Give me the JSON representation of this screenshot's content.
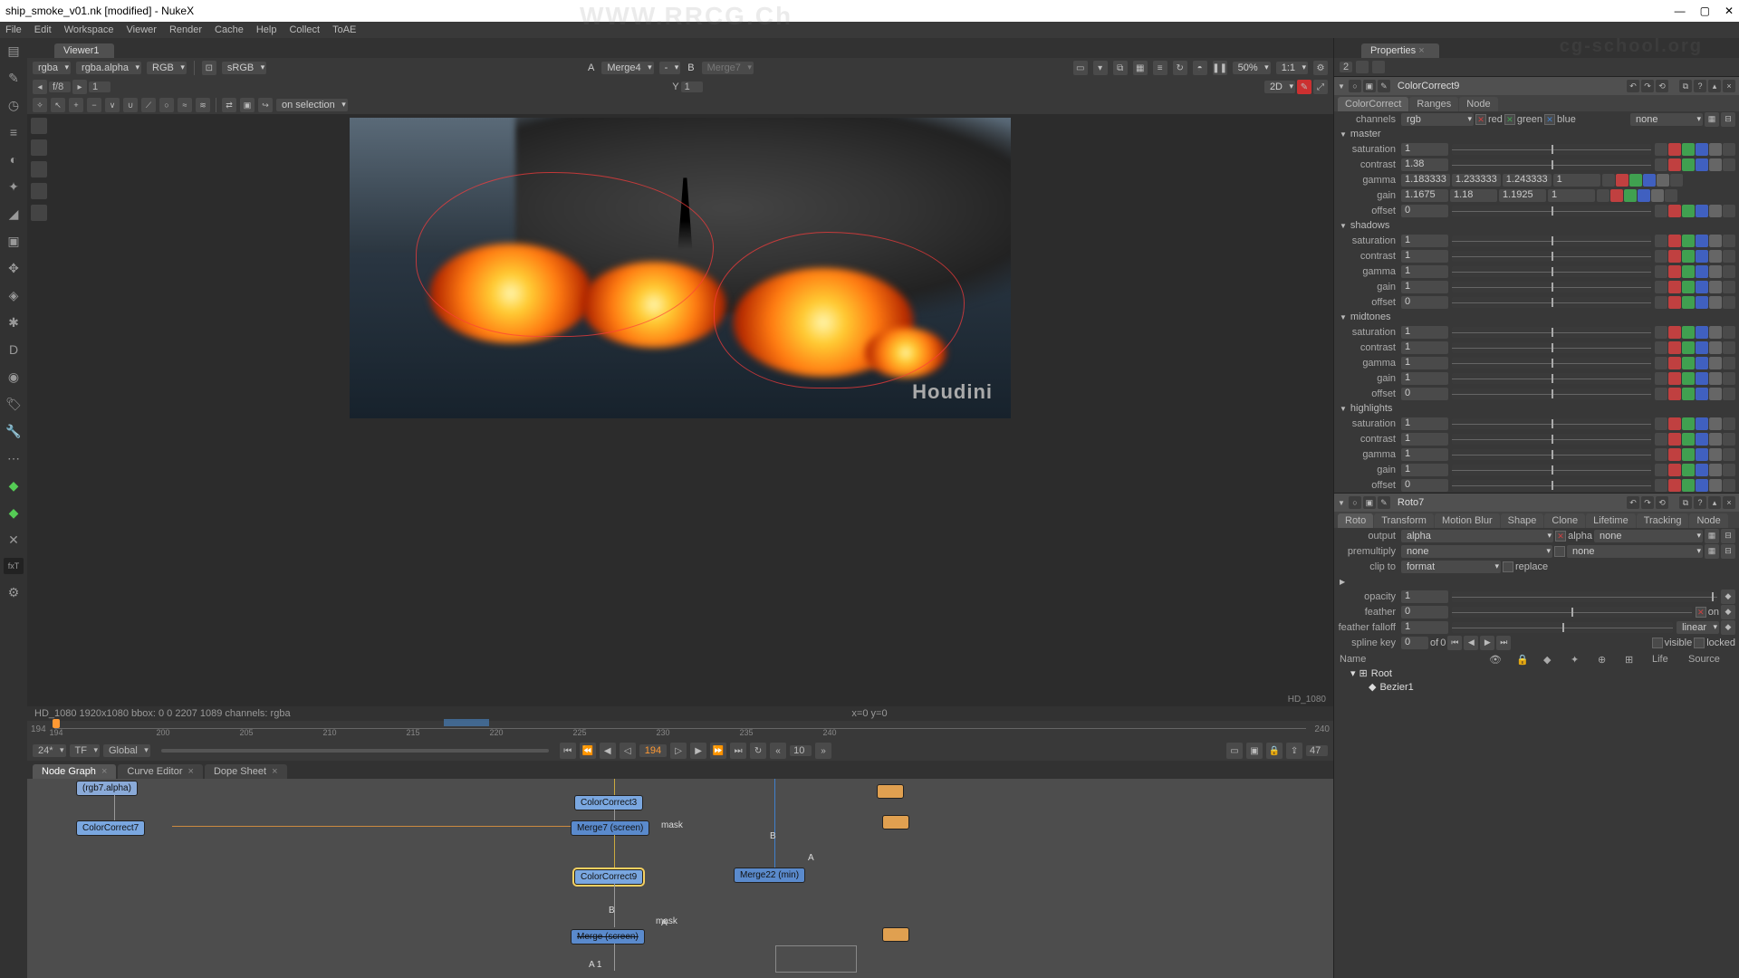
{
  "window": {
    "title": "ship_smoke_v01.nk [modified] - NukeX"
  },
  "menubar": [
    "File",
    "Edit",
    "Workspace",
    "Viewer",
    "Render",
    "Cache",
    "Help",
    "Collect",
    "ToAE"
  ],
  "viewer": {
    "tab": "Viewer1",
    "channel_combo": "rgba",
    "alpha_combo": "rgba.alpha",
    "layer_combo": "RGB",
    "lut_combo": "sRGB",
    "a_label": "A",
    "a_node": "Merge4",
    "a_dash": "-",
    "b_label": "B",
    "b_node": "Merge7",
    "zoom": "50%",
    "ratio": "1:1",
    "frame_fwd": "f/8",
    "frame_no": "1",
    "yl": "Y",
    "yval": "1",
    "mode": "2D",
    "onsel": "on selection",
    "format": "HD_1080",
    "status": "HD_1080 1920x1080  bbox: 0 0 2207 1089 channels: rgba",
    "status_xy": "x=0 y=0",
    "houdini": "Houdini"
  },
  "timeline": {
    "start": "194",
    "end": "240",
    "current": "194",
    "ticks": [
      "194",
      "200",
      "205",
      "210",
      "215",
      "220",
      "225",
      "230",
      "235",
      "240"
    ],
    "fps": "24*",
    "mode": "TF",
    "scope": "Global",
    "step": "10",
    "endframe": "47"
  },
  "node_tabs": {
    "graph": "Node Graph",
    "curve": "Curve Editor",
    "dope": "Dope Sheet"
  },
  "nodes": {
    "rgb7": "(rgb7.alpha)",
    "cc7": "ColorCorrect7",
    "cc3": "ColorCorrect3",
    "m7": "Merge7 (screen)",
    "mask1": "mask",
    "cc9": "ColorCorrect9",
    "m22": "Merge22 (min)",
    "m_bot": "Merge   (screen)",
    "mask2": "mask",
    "b1": "B",
    "b2": "B",
    "b3": "B",
    "a1": "A",
    "a2": "A  1"
  },
  "properties": {
    "tab": "Properties",
    "count": "2",
    "panel1": {
      "name": "ColorCorrect9",
      "tabs": [
        "ColorCorrect",
        "Ranges",
        "Node"
      ],
      "channels_lbl": "channels",
      "channels": "rgb",
      "red": "red",
      "green": "green",
      "blue": "blue",
      "none": "none",
      "master": "master",
      "rows": {
        "saturation": {
          "lbl": "saturation",
          "v": "1"
        },
        "contrast": {
          "lbl": "contrast",
          "v": "1.38"
        },
        "gamma": {
          "lbl": "gamma",
          "v1": "1.183333",
          "v2": "1.233333",
          "v3": "1.243333",
          "v4": "1"
        },
        "gain": {
          "lbl": "gain",
          "v1": "1.1675",
          "v2": "1.18",
          "v3": "1.1925",
          "v4": "1"
        },
        "offset": {
          "lbl": "offset",
          "v": "0"
        }
      },
      "shadows": "shadows",
      "midtones": "midtones",
      "highlights": "highlights",
      "generic": {
        "saturation": "saturation",
        "contrast": "contrast",
        "gamma": "gamma",
        "gain": "gain",
        "offset": "offset",
        "one": "1",
        "zero": "0"
      }
    },
    "panel2": {
      "name": "Roto7",
      "tabs": [
        "Roto",
        "Transform",
        "Motion Blur",
        "Shape",
        "Clone",
        "Lifetime",
        "Tracking",
        "Node"
      ],
      "output_lbl": "output",
      "output": "alpha",
      "alpha": "alpha",
      "none": "none",
      "premult_lbl": "premultiply",
      "premult": "none",
      "none2": "none",
      "clip_lbl": "clip to",
      "clip": "format",
      "replace": "replace",
      "opacity_lbl": "opacity",
      "opacity": "1",
      "feather_lbl": "feather",
      "feather": "0",
      "on": "on",
      "falloff_lbl": "feather falloff",
      "falloff": "1",
      "falloff_type": "linear",
      "spline_lbl": "spline key",
      "spline": "0",
      "of": "of",
      "spline_max": "0",
      "visible": "visible",
      "locked": "locked",
      "outline_hdr": {
        "name": "Name",
        "life": "Life",
        "source": "Source"
      },
      "root": "Root",
      "bezier": "Bezier1"
    }
  },
  "watermarks": {
    "top": "WWW.RRCG.Ch",
    "corner": "cg-school.org"
  }
}
